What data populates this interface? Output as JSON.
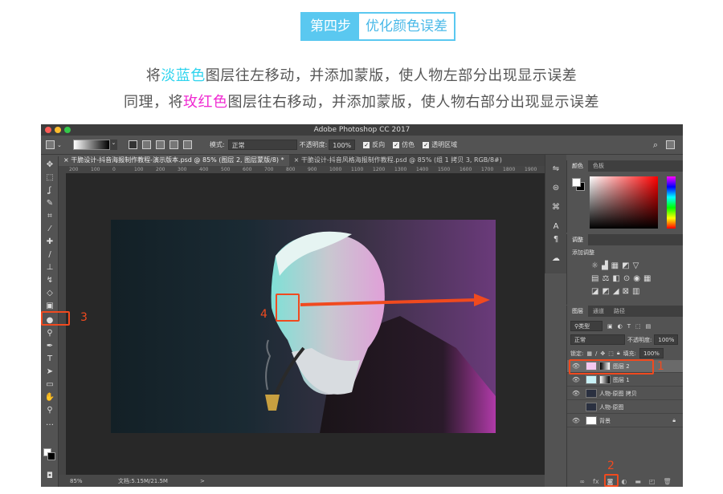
{
  "header": {
    "step_number": "第四步",
    "step_title": "优化颜色误差"
  },
  "description": {
    "line1": {
      "pre": "将",
      "highlight": "淡蓝色",
      "post": "图层往左移动，并添加蒙版，使人物左部分出现显示误差"
    },
    "line2": {
      "pre": "同理，将",
      "highlight": "玫红色",
      "post": "图层往右移动，并添加蒙版，使人物右部分出现显示误差"
    },
    "colors": {
      "blue": "#2fd4ee",
      "pink": "#f02bd2",
      "accent": "#5ac8f0",
      "annotation": "#f04a1f"
    }
  },
  "app": {
    "title": "Adobe Photoshop CC 2017",
    "options": {
      "mode_label": "模式:",
      "mode_value": "正常",
      "opacity_label": "不透明度:",
      "opacity_value": "100%",
      "reverse_label": "反向",
      "dither_label": "仿色",
      "transparency_label": "透明区域"
    },
    "tabs": [
      {
        "label": "干脆设计-抖音海报制作教程-演示版本.psd @ 85% (图层 2, 图层蒙版/8) *",
        "active": true
      },
      {
        "label": "干脆设计-抖音风格海报制作教程.psd @ 85% (组 1 拷贝 3, RGB/8#)",
        "active": false
      }
    ],
    "ruler_ticks": [
      "200",
      "100",
      "0",
      "100",
      "200",
      "300",
      "400",
      "500",
      "600",
      "700",
      "800",
      "900",
      "1000",
      "1100",
      "1200",
      "1300",
      "1400",
      "1500",
      "1600",
      "1700",
      "1800",
      "1900"
    ],
    "status": {
      "zoom": "85%",
      "doc": "文档:5.15M/21.5M",
      "arrow": ">"
    },
    "tools": [
      "move",
      "marquee",
      "lasso",
      "quick-select",
      "crop",
      "eyedropper",
      "healing",
      "brush",
      "stamp",
      "history-brush",
      "eraser",
      "gradient",
      "blur",
      "dodge",
      "pen",
      "type",
      "path-select",
      "rectangle",
      "hand",
      "zoom",
      "more"
    ],
    "color_panel": {
      "tabs": [
        "颜色",
        "色板"
      ]
    },
    "adjust_panel": {
      "tab": "调整",
      "add_label": "添加调整"
    },
    "layers_panel": {
      "tabs": [
        "图层",
        "通道",
        "路径"
      ],
      "filter_label": "类型",
      "blend_mode": "正常",
      "opacity_label": "不透明度:",
      "opacity_value": "100%",
      "lock_label": "锁定:",
      "fill_label": "填充:",
      "fill_value": "100%",
      "layers": [
        {
          "name": "图层 2",
          "visible": true,
          "has_mask": true,
          "selected": true
        },
        {
          "name": "图层 1",
          "visible": true,
          "has_mask": true,
          "selected": false
        },
        {
          "name": "人物-原图 拷贝",
          "visible": true,
          "has_mask": false,
          "selected": false
        },
        {
          "name": "人物-原图",
          "visible": false,
          "has_mask": false,
          "selected": false
        },
        {
          "name": "背景",
          "visible": true,
          "has_mask": false,
          "locked": true,
          "selected": false
        }
      ]
    }
  },
  "annotations": {
    "n1": "1",
    "n2": "2",
    "n3": "3",
    "n4": "4"
  }
}
